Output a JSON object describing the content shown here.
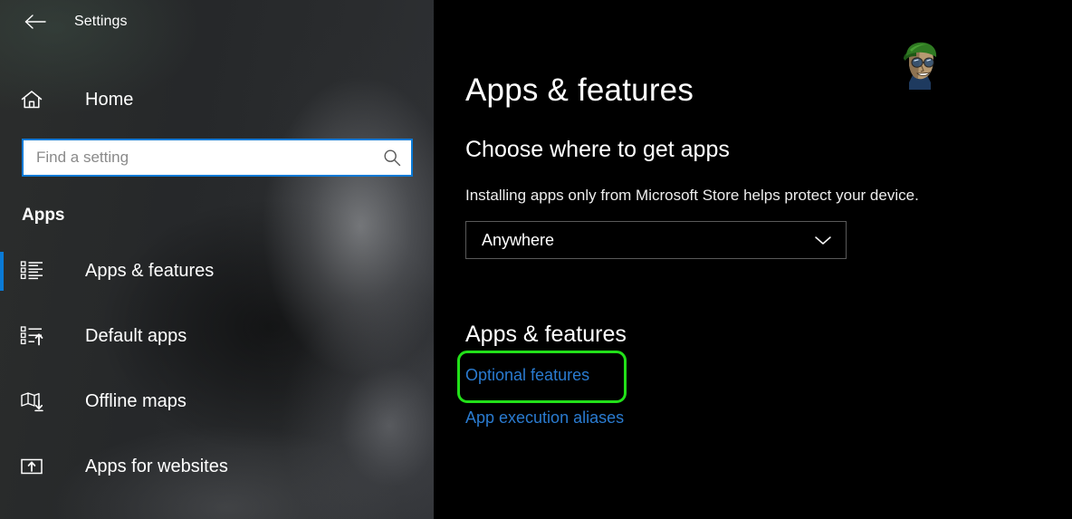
{
  "window": {
    "title": "Settings",
    "back_icon": "back-arrow-icon"
  },
  "sidebar": {
    "home": {
      "label": "Home",
      "icon": "home-icon"
    },
    "search": {
      "value": "",
      "placeholder": "Find a setting",
      "icon": "search-icon"
    },
    "group_title": "Apps",
    "items": [
      {
        "label": "Apps & features",
        "icon": "list-bullet-icon",
        "selected": true
      },
      {
        "label": "Default apps",
        "icon": "list-arrow-up-icon",
        "selected": false
      },
      {
        "label": "Offline maps",
        "icon": "map-download-icon",
        "selected": false
      },
      {
        "label": "Apps for websites",
        "icon": "window-arrow-up-icon",
        "selected": false
      }
    ]
  },
  "main": {
    "page_title": "Apps & features",
    "section_one": {
      "title": "Choose where to get apps",
      "description": "Installing apps only from Microsoft Store helps protect your device.",
      "dropdown": {
        "value": "Anywhere",
        "chevron_icon": "chevron-down-icon"
      }
    },
    "section_two": {
      "title": "Apps & features",
      "links": [
        {
          "label": "Optional features",
          "highlighted": true
        },
        {
          "label": "App execution aliases",
          "highlighted": false
        }
      ]
    }
  },
  "annotation": {
    "type": "rounded-rectangle-outline",
    "target": "Optional features",
    "color": "#22e019"
  },
  "watermark": {
    "name": "cartoon-face-logo",
    "cap_color": "#2f7a22",
    "skin_color": "#b79a72",
    "glasses_color": "#3b5f8a"
  },
  "colors": {
    "accent": "#0a7ad6",
    "link": "#2a7bd0",
    "annotation": "#22e019",
    "sidebar_bg": "#262626",
    "main_bg": "#000000",
    "text": "#ffffff"
  }
}
